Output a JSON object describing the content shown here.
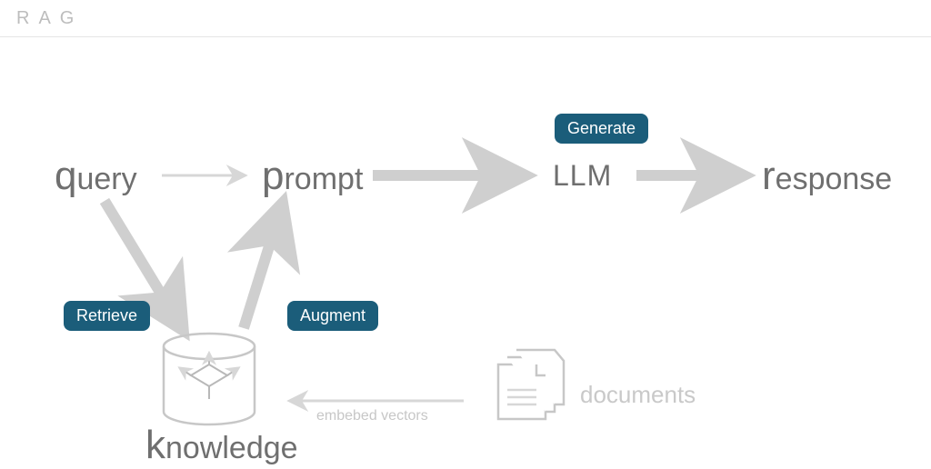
{
  "header": {
    "title": "RAG"
  },
  "nodes": {
    "query": {
      "lead": "q",
      "rest": "uery"
    },
    "prompt": {
      "lead": "p",
      "rest": "rompt"
    },
    "llm": {
      "text": "LLM"
    },
    "response": {
      "lead": "r",
      "rest": "esponse"
    },
    "knowledge": {
      "lead": "k",
      "rest": "nowledge"
    },
    "documents": {
      "text": "documents"
    }
  },
  "badges": {
    "retrieve": "Retrieve",
    "augment": "Augment",
    "generate": "Generate"
  },
  "annotations": {
    "embed": "embebed vectors"
  },
  "colors": {
    "badge_bg": "#1b5d7a",
    "text_muted": "#6f6f6f",
    "text_faint": "#c7c7c7",
    "arrow": "#d7d7d7"
  }
}
